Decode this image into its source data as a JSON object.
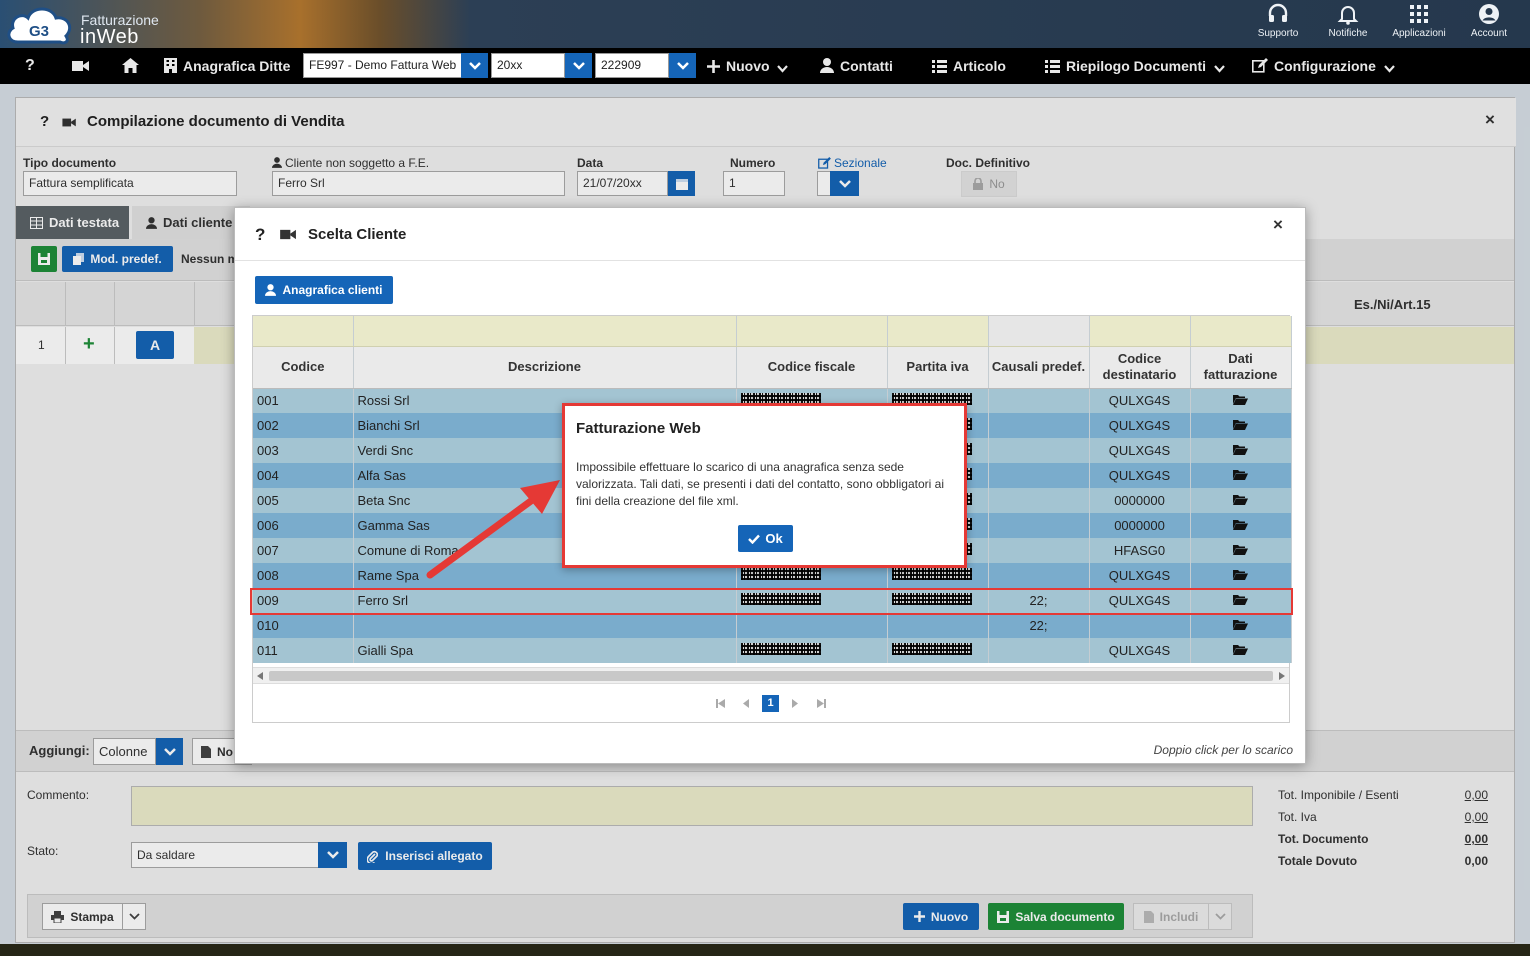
{
  "app": {
    "logo_line1": "Fatturazione",
    "logo_line2": "inWeb"
  },
  "topbar": {
    "icons": [
      {
        "name": "supporto",
        "label": "Supporto",
        "icon": "headset-icon"
      },
      {
        "name": "notifiche",
        "label": "Notifiche",
        "icon": "bell-icon"
      },
      {
        "name": "applicazioni",
        "label": "Applicazioni",
        "icon": "grid-icon"
      },
      {
        "name": "account",
        "label": "Account",
        "icon": "user-circle-icon"
      }
    ]
  },
  "menubar": {
    "help": "?",
    "anagrafica_ditte": "Anagrafica Ditte",
    "company_select": "FE997 - Demo Fattura Web",
    "year_select": "20xx",
    "code_select": "222909",
    "nuovo": "Nuovo",
    "contatti": "Contatti",
    "articolo": "Articolo",
    "riepilogo": "Riepilogo Documenti",
    "configurazione": "Configurazione"
  },
  "window": {
    "help": "?",
    "title": "Compilazione documento di Vendita",
    "close": "×",
    "fields": {
      "tipo_documento_label": "Tipo documento",
      "tipo_documento_value": "Fattura semplificata",
      "cliente_label": "Cliente non soggetto a F.E.",
      "cliente_value": "Ferro Srl",
      "data_label": "Data",
      "data_value": "21/07/20xx",
      "numero_label": "Numero",
      "numero_value": "1",
      "sezionale_label": "Sezionale",
      "doc_definitivo_label": "Doc. Definitivo",
      "doc_definitivo_value": "No"
    },
    "tabs": {
      "dati_testata": "Dati testata",
      "dati_cliente": "Dati cliente"
    },
    "toolbar": {
      "mod_predef": "Mod. predef.",
      "nessun": "Nessun m"
    },
    "lines": {
      "row_num": "1",
      "add": "+",
      "a_btn": "A",
      "es_col": "Es./Ni/Art.15"
    },
    "aggiungi_label": "Aggiungi:",
    "colonne": "Colonne",
    "no_btn": "No",
    "commento_label": "Commento:",
    "stato_label": "Stato:",
    "stato_value": "Da saldare",
    "inserisci_allegato": "Inserisci allegato",
    "totals": [
      {
        "label": "Tot. Imponibile / Esenti",
        "value": "0,00",
        "bold": false
      },
      {
        "label": "Tot. Iva",
        "value": "0,00",
        "bold": false
      },
      {
        "label": "Tot. Documento",
        "value": "0,00",
        "bold": true
      },
      {
        "label": "Totale Dovuto",
        "value": "0,00",
        "bold": true
      }
    ],
    "stampa": "Stampa",
    "nuovo": "Nuovo",
    "salva": "Salva documento",
    "includi": "Includi"
  },
  "modal": {
    "help": "?",
    "title": "Scelta Cliente",
    "close": "×",
    "anagrafica_btn": "Anagrafica clienti",
    "columns": [
      "Codice",
      "Descrizione",
      "Codice fiscale",
      "Partita iva",
      "Causali predef.",
      "Codice destinatario",
      "Dati fatturazione"
    ],
    "rows": [
      {
        "codice": "001",
        "descrizione": "Rossi Srl",
        "cf": true,
        "piva": true,
        "causali": "",
        "dest": "QULXG4S"
      },
      {
        "codice": "002",
        "descrizione": "Bianchi Srl",
        "cf": true,
        "piva": true,
        "causali": "",
        "dest": "QULXG4S"
      },
      {
        "codice": "003",
        "descrizione": "Verdi Snc",
        "cf": true,
        "piva": true,
        "causali": "",
        "dest": "QULXG4S"
      },
      {
        "codice": "004",
        "descrizione": "Alfa Sas",
        "cf": true,
        "piva": true,
        "causali": "",
        "dest": "QULXG4S"
      },
      {
        "codice": "005",
        "descrizione": "Beta Snc",
        "cf": true,
        "piva": true,
        "causali": "",
        "dest": "0000000"
      },
      {
        "codice": "006",
        "descrizione": "Gamma Sas",
        "cf": true,
        "piva": true,
        "causali": "",
        "dest": "0000000"
      },
      {
        "codice": "007",
        "descrizione": "Comune di Roma",
        "cf": true,
        "piva": true,
        "causali": "",
        "dest": "HFASG0"
      },
      {
        "codice": "008",
        "descrizione": "Rame Spa",
        "cf": true,
        "piva": true,
        "causali": "",
        "dest": "QULXG4S"
      },
      {
        "codice": "009",
        "descrizione": "Ferro Srl",
        "cf": true,
        "piva": true,
        "causali": "22;",
        "dest": "QULXG4S"
      },
      {
        "codice": "010",
        "descrizione": "",
        "cf": false,
        "piva": false,
        "causali": "22;",
        "dest": ""
      },
      {
        "codice": "011",
        "descrizione": "Gialli Spa",
        "cf": true,
        "piva": true,
        "causali": "",
        "dest": "QULXG4S"
      }
    ],
    "pager_current": "1",
    "hint": "Doppio click per lo scarico"
  },
  "alert": {
    "title": "Fatturazione Web",
    "message": "Impossibile effettuare lo scarico di una anagrafica senza sede valorizzata. Tali dati, se presenti i dati del contatto, sono obbligatori ai fini della creazione del file xml.",
    "ok": "Ok"
  },
  "colors": {
    "accent": "#1565b8",
    "green": "#1f8f3a",
    "highlight": "#e53935",
    "row_a": "#a3c4d2",
    "row_b": "#7aaccc"
  }
}
